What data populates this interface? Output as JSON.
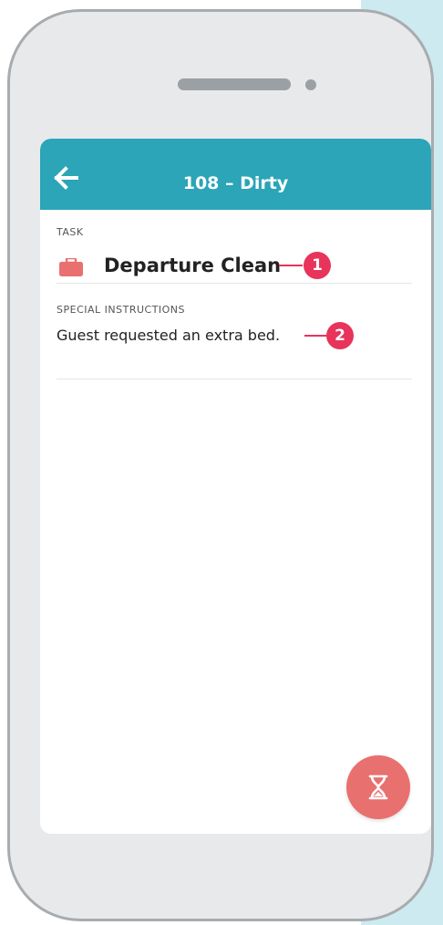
{
  "header": {
    "title": "108 – Dirty",
    "back_icon": "arrow-left-icon"
  },
  "task": {
    "section_label": "TASK",
    "name": "Departure Clean",
    "icon": "briefcase-icon",
    "callout_number": "1"
  },
  "special_instructions": {
    "section_label": "SPECIAL INSTRUCTIONS",
    "text": "Guest requested an extra bed.",
    "callout_number": "2"
  },
  "fab": {
    "icon": "hourglass-icon"
  },
  "colors": {
    "header": "#2ba5b7",
    "callout": "#e8335a",
    "fab": "#e8706f",
    "task_icon": "#e8706f"
  }
}
